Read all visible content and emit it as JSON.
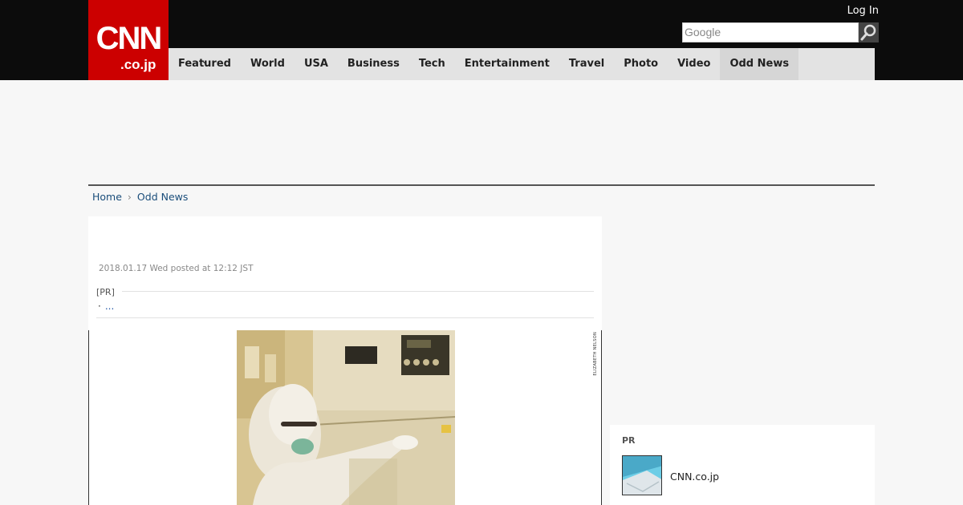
{
  "header": {
    "logo_brand": "CNN",
    "logo_suffix": ".co.jp",
    "login_label": "Log In",
    "search_placeholder": "Google",
    "brand_color": "#cc0000"
  },
  "nav": {
    "items": [
      {
        "label": "Featured",
        "has_dropdown": true
      },
      {
        "label": "World"
      },
      {
        "label": "USA"
      },
      {
        "label": "Business"
      },
      {
        "label": "Tech"
      },
      {
        "label": "Entertainment"
      },
      {
        "label": "Travel"
      },
      {
        "label": "Photo"
      },
      {
        "label": "Video"
      },
      {
        "label": "Odd News",
        "active": true
      }
    ]
  },
  "breadcrumb": {
    "home": "Home",
    "section": "Odd News"
  },
  "article": {
    "dateline": "2018.01.17 Wed posted at 12:12 JST",
    "pr_label": "[PR]",
    "pr_link": "...",
    "photo_credit": "ELIZABETH NELSON"
  },
  "sidebar": {
    "pr_head": "PR",
    "item_title": "CNN.co.jp"
  }
}
